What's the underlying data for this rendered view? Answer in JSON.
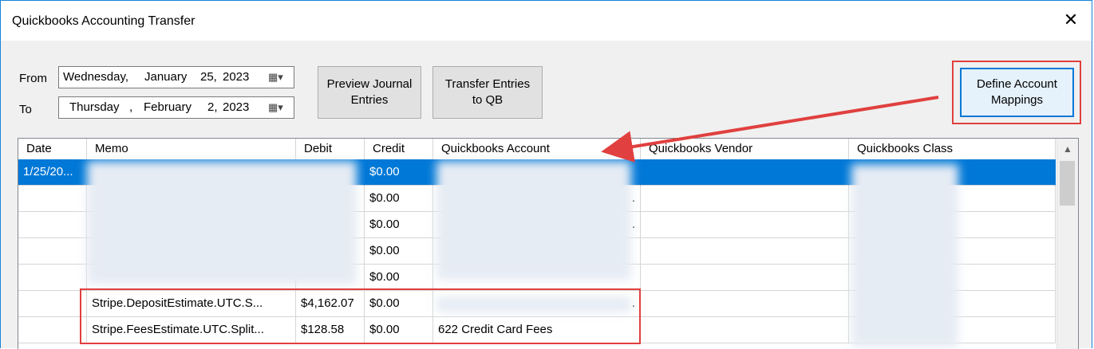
{
  "window": {
    "title": "Quickbooks Accounting Transfer",
    "close_glyph": "✕"
  },
  "filters": {
    "from_label": "From",
    "to_label": "To",
    "from_date": {
      "weekday": "Wednesday,",
      "month": "January",
      "day": "25,",
      "year": "2023"
    },
    "to_date": {
      "weekday": "Thursday",
      "sep": ",",
      "month": "February",
      "day": "2,",
      "year": "2023"
    },
    "calendar_glyph": "▦▾"
  },
  "buttons": {
    "preview_line1": "Preview Journal",
    "preview_line2": "Entries",
    "transfer_line1": "Transfer Entries",
    "transfer_line2": "to QB",
    "define_line1": "Define Account",
    "define_line2": "Mappings"
  },
  "table": {
    "columns": [
      "Date",
      "Memo",
      "Debit",
      "Credit",
      "Quickbooks Account",
      "Quickbooks Vendor",
      "Quickbooks Class"
    ],
    "rows": [
      {
        "date": "1/25/20...",
        "memo": "",
        "debit": "",
        "credit": "$0.00",
        "account": "",
        "vendor": "",
        "class": ""
      },
      {
        "date": "",
        "memo": "",
        "debit": "",
        "credit": "$0.00",
        "account": ".",
        "vendor": "",
        "class": ""
      },
      {
        "date": "",
        "memo": "",
        "debit": "",
        "credit": "$0.00",
        "account": ".",
        "vendor": "",
        "class": ""
      },
      {
        "date": "",
        "memo": "",
        "debit": "",
        "credit": "$0.00",
        "account": "",
        "vendor": "",
        "class": ""
      },
      {
        "date": "",
        "memo": "",
        "debit": "",
        "credit": "$0.00",
        "account": "",
        "vendor": "",
        "class": ""
      },
      {
        "date": "",
        "memo": "Stripe.DepositEstimate.UTC.S...",
        "debit": "$4,162.07",
        "credit": "$0.00",
        "account": ".",
        "vendor": "",
        "class": ""
      },
      {
        "date": "",
        "memo": "Stripe.FeesEstimate.UTC.Split...",
        "debit": "$128.58",
        "credit": "$0.00",
        "account": "622 Credit Card Fees",
        "vendor": "",
        "class": ""
      }
    ]
  },
  "scrollbar": {
    "up_glyph": "▲"
  },
  "colors": {
    "selection": "#0078d7",
    "highlight": "#e0403f",
    "accent": "#1883d7"
  }
}
